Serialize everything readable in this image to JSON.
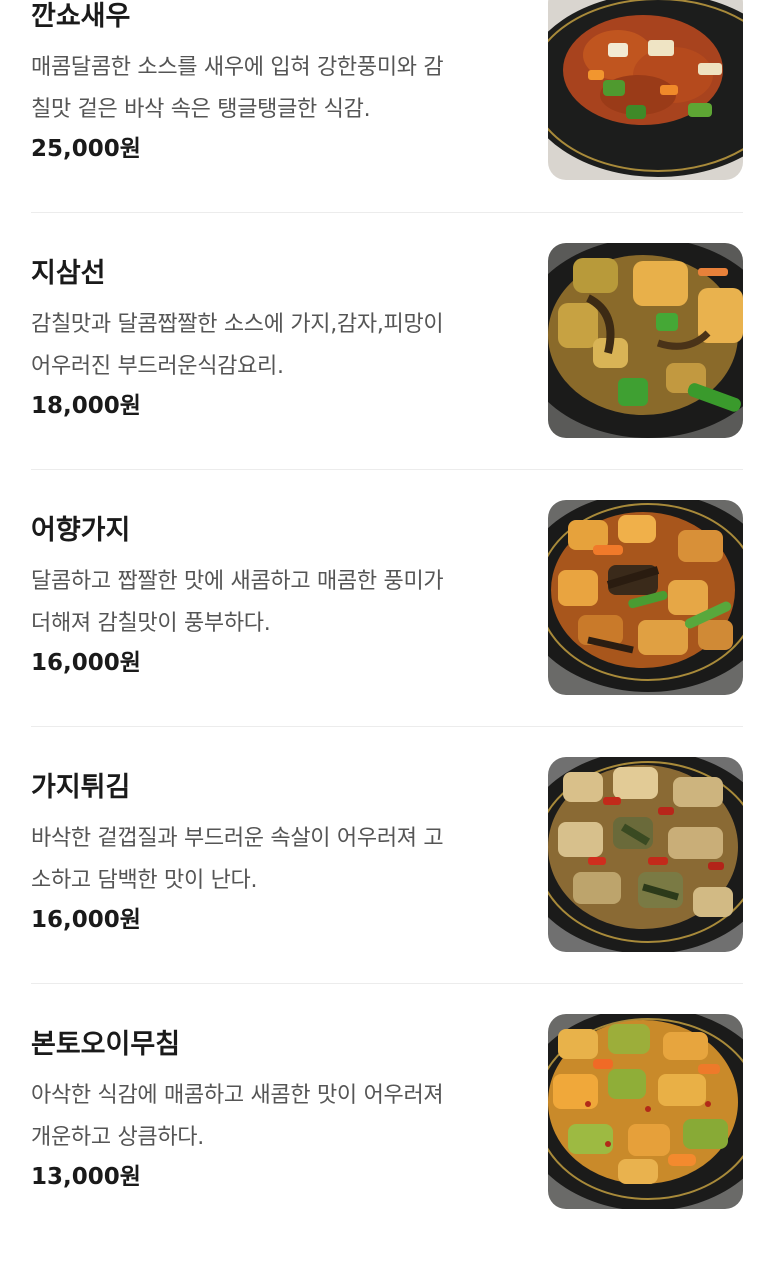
{
  "menu": {
    "items": [
      {
        "name": "깐쇼새우",
        "description_lines": [
          "매콤달콤한 소스를 새우에 입혀 강한풍미와 감",
          "칠맛 겉은 바삭 속은 탱글탱글한 식감."
        ],
        "price": "25,000원",
        "photo": "kkanshao-shrimp-photo"
      },
      {
        "name": "지삼선",
        "description_lines": [
          "감칠맛과 달콤짭짤한 소스에 가지,감자,피망이",
          "어우러진 부드러운식감요리."
        ],
        "price": "18,000원",
        "photo": "jisamseon-photo"
      },
      {
        "name": "어향가지",
        "description_lines": [
          "달콤하고 짭짤한 맛에 새콤하고 매콤한 풍미가",
          "더해져 감칠맛이 풍부하다."
        ],
        "price": "16,000원",
        "photo": "eohyang-eggplant-photo"
      },
      {
        "name": "가지튀김",
        "description_lines": [
          "바삭한 겉껍질과 부드러운 속살이 어우러져 고",
          "소하고 담백한 맛이 난다."
        ],
        "price": "16,000원",
        "photo": "fried-eggplant-photo"
      },
      {
        "name": "본토오이무침",
        "description_lines": [
          "아삭한 식감에 매콤하고 새콤한 맛이 어우러져",
          "개운하고 상큼하다."
        ],
        "price": "13,000원",
        "photo": "cucumber-salad-photo"
      }
    ]
  }
}
